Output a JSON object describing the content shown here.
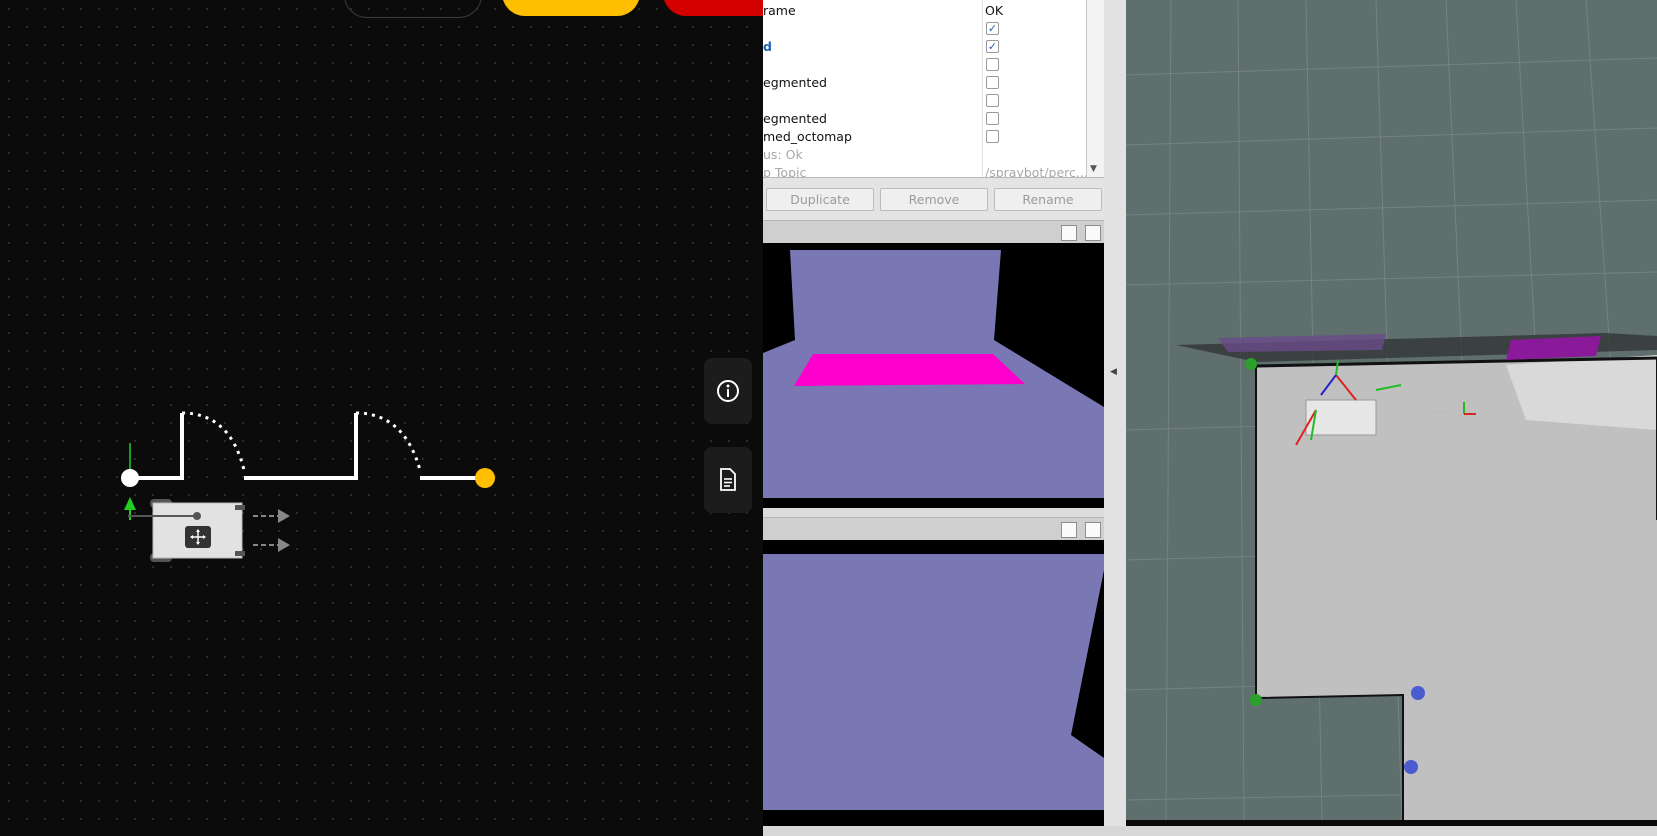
{
  "planner": {
    "buttons": {
      "info_icon": "info-circle-icon",
      "doc_icon": "document-icon",
      "move_icon": "move-arrows-icon"
    },
    "colors": {
      "start_marker": "#ffffff",
      "goal_marker": "#ffbe00",
      "stop_pill": "#d40000",
      "accent_pill": "#ffbe00",
      "heading_arrow": "#22cc22"
    }
  },
  "displays": {
    "rows": [
      {
        "label": "rame",
        "value": "OK",
        "style": "normal",
        "type": "text"
      },
      {
        "label": "",
        "value": "",
        "style": "normal",
        "type": "checkbox",
        "checked": true
      },
      {
        "label": "d",
        "value": "",
        "style": "blue",
        "type": "checkbox",
        "checked": true
      },
      {
        "label": "",
        "value": "",
        "style": "normal",
        "type": "checkbox",
        "checked": false
      },
      {
        "label": "egmented",
        "value": "",
        "style": "normal",
        "type": "checkbox",
        "checked": false
      },
      {
        "label": "",
        "value": "",
        "style": "normal",
        "type": "checkbox",
        "checked": false
      },
      {
        "label": "egmented",
        "value": "",
        "style": "normal",
        "type": "checkbox",
        "checked": false
      },
      {
        "label": "med_octomap",
        "value": "",
        "style": "normal",
        "type": "checkbox",
        "checked": false
      },
      {
        "label": "us: Ok",
        "value": "",
        "style": "grey",
        "type": "text"
      },
      {
        "label": "p Topic",
        "value": "/spraybot/perc...",
        "style": "grey",
        "type": "text"
      }
    ],
    "buttons": {
      "duplicate": "Duplicate",
      "remove": "Remove",
      "rename": "Rename"
    }
  },
  "camera_colors": {
    "wall": "#7977b4",
    "object": "#ff00cc",
    "background": "#000000"
  },
  "scene_colors": {
    "background": "#5e6f6e",
    "floor": "#c0c0c0",
    "obstacle": "#8a1a9a",
    "marker_green": "#2ca02c",
    "marker_blue": "#4b5bd0"
  }
}
